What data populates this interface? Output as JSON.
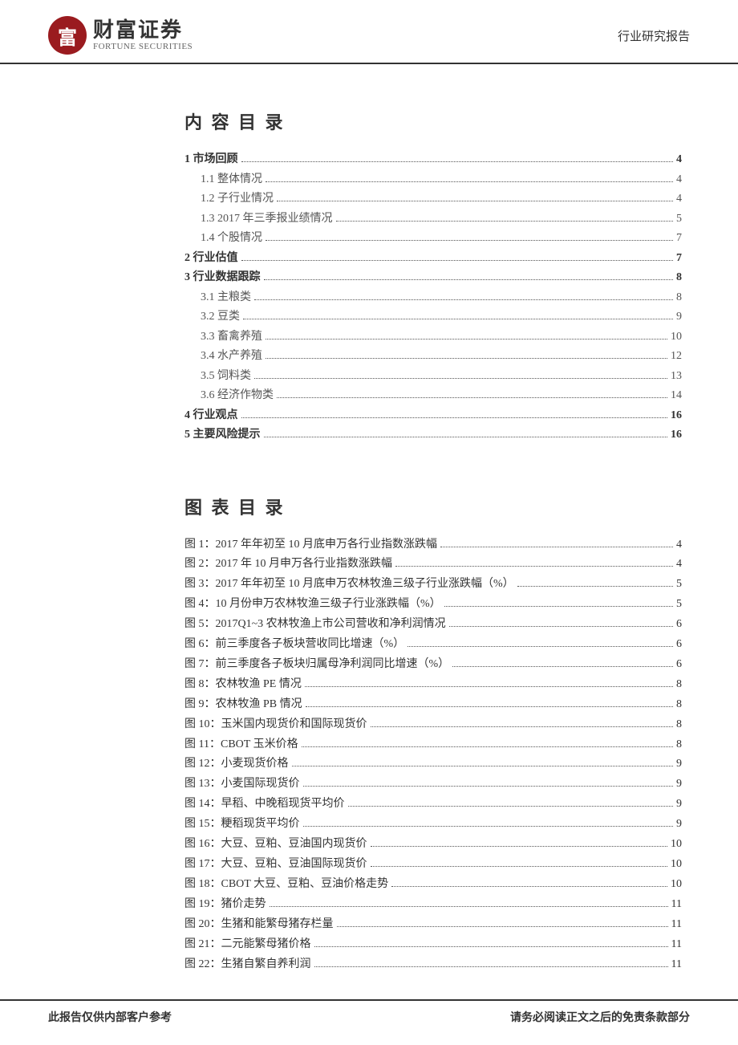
{
  "header": {
    "logo_seal": "富",
    "logo_cn": "财富证券",
    "logo_en": "FORTUNE SECURITIES",
    "right_label": "行业研究报告"
  },
  "toc_title": "内 容 目 录",
  "toc": [
    {
      "level": 1,
      "label": "1 市场回顾",
      "page": "4"
    },
    {
      "level": 2,
      "label": "1.1 整体情况",
      "page": "4"
    },
    {
      "level": 2,
      "label": "1.2 子行业情况",
      "page": "4"
    },
    {
      "level": 2,
      "label": "1.3 2017 年三季报业绩情况",
      "page": "5"
    },
    {
      "level": 2,
      "label": "1.4 个股情况",
      "page": "7"
    },
    {
      "level": 1,
      "label": "2 行业估值",
      "page": "7"
    },
    {
      "level": 1,
      "label": "3 行业数据跟踪",
      "page": "8"
    },
    {
      "level": 2,
      "label": "3.1 主粮类",
      "page": "8"
    },
    {
      "level": 2,
      "label": "3.2 豆类",
      "page": "9"
    },
    {
      "level": 2,
      "label": "3.3 畜禽养殖",
      "page": "10"
    },
    {
      "level": 2,
      "label": "3.4 水产养殖",
      "page": "12"
    },
    {
      "level": 2,
      "label": "3.5 饲料类",
      "page": "13"
    },
    {
      "level": 2,
      "label": "3.6 经济作物类",
      "page": "14"
    },
    {
      "level": 1,
      "label": "4 行业观点",
      "page": "16"
    },
    {
      "level": 1,
      "label": "5 主要风险提示",
      "page": "16"
    }
  ],
  "fig_title": "图 表 目 录",
  "figures": [
    {
      "label": "图 1：2017 年年初至 10 月底申万各行业指数涨跌幅",
      "page": "4"
    },
    {
      "label": "图 2：2017 年 10 月申万各行业指数涨跌幅",
      "page": "4"
    },
    {
      "label": "图 3：2017 年年初至 10 月底申万农林牧渔三级子行业涨跌幅（%）",
      "page": "5"
    },
    {
      "label": "图 4：10 月份申万农林牧渔三级子行业涨跌幅（%）",
      "page": "5"
    },
    {
      "label": "图 5：2017Q1~3 农林牧渔上市公司营收和净利润情况",
      "page": "6"
    },
    {
      "label": "图 6：前三季度各子板块营收同比增速（%）",
      "page": "6"
    },
    {
      "label": "图 7：前三季度各子板块归属母净利润同比增速（%）",
      "page": "6"
    },
    {
      "label": "图 8：农林牧渔 PE 情况",
      "page": "8"
    },
    {
      "label": "图 9：农林牧渔 PB 情况",
      "page": "8"
    },
    {
      "label": "图 10：玉米国内现货价和国际现货价",
      "page": "8"
    },
    {
      "label": "图 11：CBOT 玉米价格",
      "page": "8"
    },
    {
      "label": "图 12：小麦现货价格",
      "page": "9"
    },
    {
      "label": "图 13：小麦国际现货价",
      "page": "9"
    },
    {
      "label": "图 14：早稻、中晚稻现货平均价",
      "page": "9"
    },
    {
      "label": "图 15：粳稻现货平均价",
      "page": "9"
    },
    {
      "label": "图 16：大豆、豆粕、豆油国内现货价",
      "page": "10"
    },
    {
      "label": "图 17：大豆、豆粕、豆油国际现货价",
      "page": "10"
    },
    {
      "label": "图 18：CBOT 大豆、豆粕、豆油价格走势",
      "page": "10"
    },
    {
      "label": "图 19：猪价走势",
      "page": "11"
    },
    {
      "label": "图 20：生猪和能繁母猪存栏量",
      "page": "11"
    },
    {
      "label": "图 21：二元能繁母猪价格",
      "page": "11"
    },
    {
      "label": "图 22：生猪自繁自养利润",
      "page": "11"
    }
  ],
  "footer": {
    "left": "此报告仅供内部客户参考",
    "right": "请务必阅读正文之后的免责条款部分"
  }
}
